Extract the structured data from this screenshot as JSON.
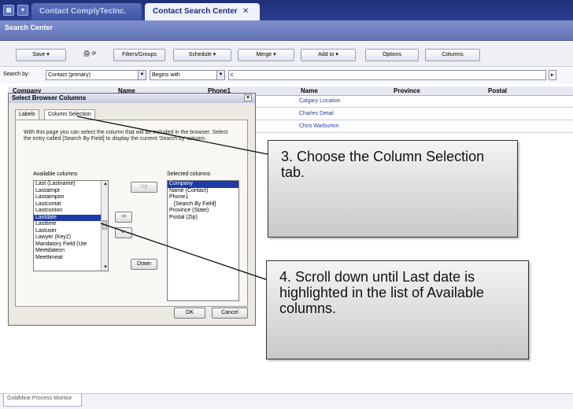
{
  "tabs": [
    {
      "label": "Contact ComplyTecInc."
    },
    {
      "label": "Contact Search Center",
      "close": "✕"
    }
  ],
  "section_title": "Search Center",
  "toolbar": {
    "save": "Save",
    "filters": "Filters/Groups",
    "schedule": "Schedule",
    "merge": "Merge",
    "addto": "Add to",
    "options": "Options",
    "columns": "Columns"
  },
  "search": {
    "label": "Search by:",
    "field": "Contact (primary)",
    "mode": "Begins with",
    "value": "c"
  },
  "grid": {
    "headers": [
      "Company",
      "Name",
      "Phone1",
      "Name",
      "Province",
      "Postal"
    ],
    "rows": [
      "Calgary Location",
      "Charles Detail",
      "Chris Warburton"
    ]
  },
  "dialog": {
    "title": "Select Browser Columns",
    "close": "×",
    "tab_labels": "Labels",
    "tab_column": "Column Selection",
    "description": "With this page you can select the column that will be included in the browser. Select the entry called [Search By Field] to display the current 'Search by' column.",
    "available_label": "Available columns",
    "selected_label": "Selected columns",
    "available": [
      "Last (Lastname)",
      "Lastatmpt",
      "Lastatmpon",
      "Lastcontat",
      "Lastconton",
      "Lastdate",
      "Lasttime",
      "Lastuser",
      "Lawyer (Key2)",
      "Mandatory Field (Ute",
      "Meetdateon",
      "Meettimeat"
    ],
    "selected": [
      "Company",
      "Name (Contact)",
      "Phone1",
      "[Search By Field]",
      "Province (State)",
      "Postal (Zip)"
    ],
    "btn_up": "Up",
    "btn_add": "->",
    "btn_remove": "<-",
    "btn_down": "Down",
    "btn_ok": "OK",
    "btn_cancel": "Cancel"
  },
  "callouts": {
    "step3": "3. Choose the Column Selection tab.",
    "step4": "4. Scroll down until Last date is highlighted in the list of Available columns."
  },
  "status": {
    "process_monitor": "GoldMine Process Monitor"
  },
  "colors": {
    "titlebar": "#1f2f78",
    "section": "#6f80c2",
    "highlight": "#1c3aa8",
    "link": "#2b3fa0"
  }
}
